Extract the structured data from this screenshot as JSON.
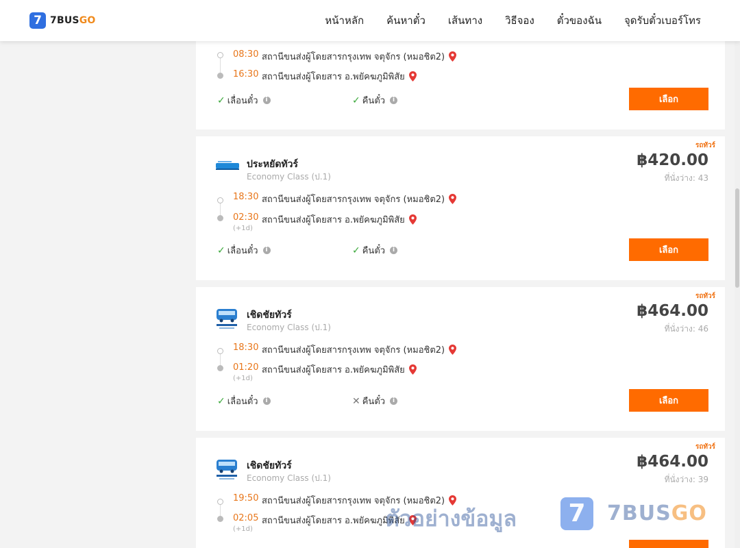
{
  "header": {
    "logo_digit": "7",
    "logo_bus": "BUS",
    "logo_go": "GO",
    "nav": [
      "หน้าหลัก",
      "ค้นหาตั๋ว",
      "เส้นทาง",
      "วิธีจอง",
      "ตั๋วของฉัน",
      "จุดรับตั๋วเบอร์โทร"
    ]
  },
  "colors": {
    "accent": "#ff6b00",
    "time": "#e8761a",
    "brand_blue": "#2f6fe0",
    "ok": "#3aa83a"
  },
  "cards": [
    {
      "dep_time": "08:30",
      "dep_station": "สถานีขนส่งผู้โดยสารกรุงเทพ จตุจักร (หมอชิต2)",
      "arr_time": "16:30",
      "arr_station": "สถานีขนส่งผู้โดยสาร อ.พยัคฆภูมิพิสัย",
      "feature_change": "เลื่อนตั๋ว",
      "feature_refund": "คืนตั๋ว",
      "select": "เลือก"
    },
    {
      "tag": "รถทัวร์",
      "operator": "ประหยัดทัวร์",
      "class": "Economy Class (ป.1)",
      "price": "฿420.00",
      "seats": "ที่นั่งว่าง: 43",
      "dep_time": "18:30",
      "dep_station": "สถานีขนส่งผู้โดยสารกรุงเทพ จตุจักร (หมอชิต2)",
      "arr_time": "02:30",
      "arr_station": "สถานีขนส่งผู้โดยสาร อ.พยัคฆภูมิพิสัย",
      "next_day": "(+1d)",
      "feature_change": "เลื่อนตั๋ว",
      "feature_refund": "คืนตั๋ว",
      "select": "เลือก"
    },
    {
      "tag": "รถทัวร์",
      "operator": "เชิดชัยทัวร์",
      "class": "Economy Class (ป.1)",
      "price": "฿464.00",
      "seats": "ที่นั่งว่าง: 46",
      "dep_time": "18:30",
      "dep_station": "สถานีขนส่งผู้โดยสารกรุงเทพ จตุจักร (หมอชิต2)",
      "arr_time": "01:20",
      "arr_station": "สถานีขนส่งผู้โดยสาร อ.พยัคฆภูมิพิสัย",
      "next_day": "(+1d)",
      "feature_change": "เลื่อนตั๋ว",
      "feature_refund": "คืนตั๋ว",
      "select": "เลือก"
    },
    {
      "tag": "รถทัวร์",
      "operator": "เชิดชัยทัวร์",
      "class": "Economy Class (ป.1)",
      "price": "฿464.00",
      "seats": "ที่นั่งว่าง: 39",
      "dep_time": "19:50",
      "dep_station": "สถานีขนส่งผู้โดยสารกรุงเทพ จตุจักร (หมอชิต2)",
      "arr_time": "02:05",
      "arr_station": "สถานีขนส่งผู้โดยสาร อ.พยัคฆภูมิพิสัย",
      "next_day": "(+1d)"
    }
  ],
  "watermark": {
    "text": "ตัวอย่างข้อมูล",
    "digit": "7",
    "bus": "BUS",
    "go": "GO"
  }
}
